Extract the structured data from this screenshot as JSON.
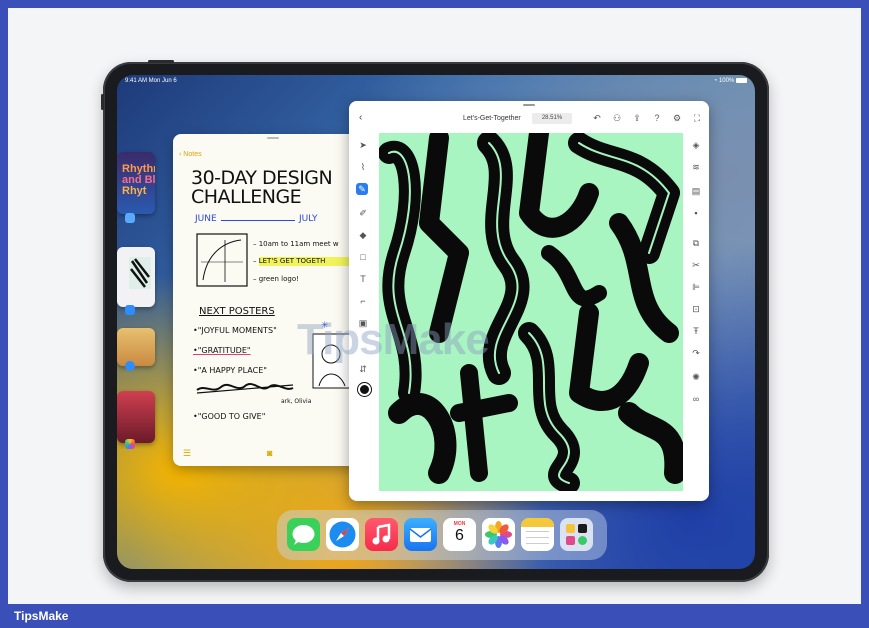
{
  "status_bar": {
    "time_date": "9:41 AM  Mon Jun 6",
    "battery": "100%"
  },
  "notes": {
    "back_label": "Notes",
    "title_line1": "30-DAY DESIGN",
    "title_line2": "CHALLENGE",
    "month_start": "JUNE",
    "month_end": "JULY",
    "list": [
      "– 10am to 11am meet w",
      "– LET'S GET TOGETH",
      "– green logo!"
    ],
    "posters_heading": "NEXT POSTERS",
    "posters": [
      "•\"JOYFUL MOMENTS\"",
      "•\"GRATITUDE\"",
      "•\"A HAPPY PLACE\"",
      "•\"GOOD TO GIVE\""
    ],
    "credit": "ark, Olivia"
  },
  "sketch_app": {
    "doc_title": "Let's-Get-Together",
    "zoom": "28.51%"
  },
  "stage_cards": {
    "music_text": "Rhythm and Bl Rhyt"
  },
  "dock": {
    "icons": [
      "messages-icon",
      "safari-icon",
      "music-icon",
      "mail-icon",
      "calendar-icon",
      "photos-icon",
      "notes-icon",
      "app-library-icon"
    ],
    "calendar_day": "MON",
    "calendar_date": "6"
  },
  "watermark": "TipsMake",
  "footer": {
    "brand": "TipsMake"
  }
}
